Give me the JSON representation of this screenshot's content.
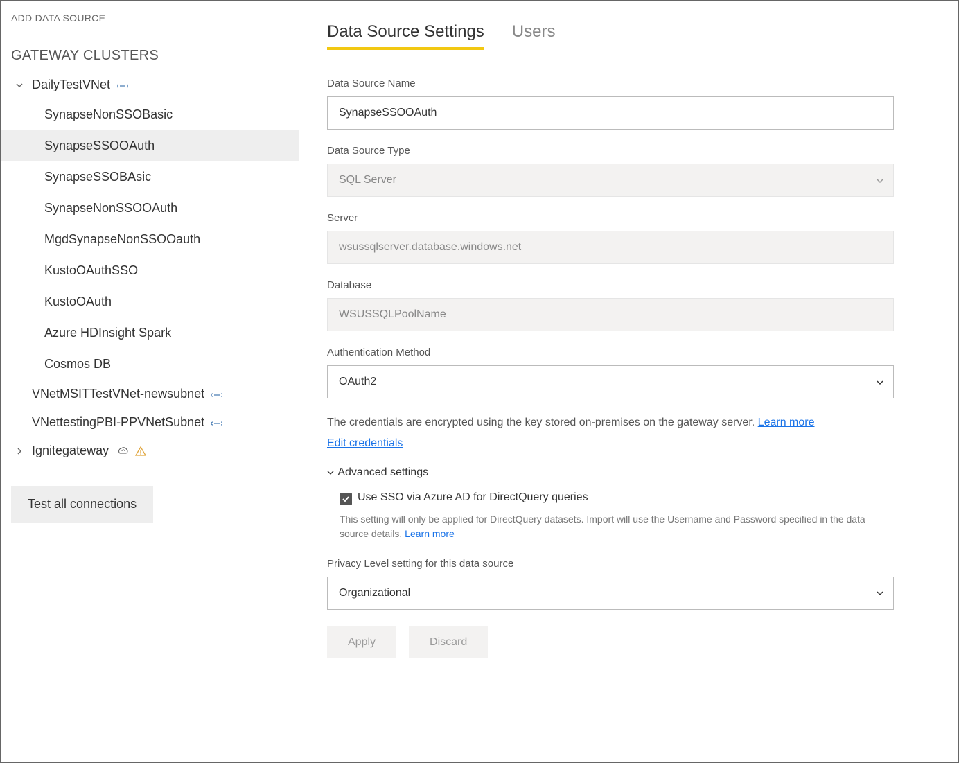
{
  "sidebar": {
    "add_link": "ADD DATA SOURCE",
    "section_title": "GATEWAY CLUSTERS",
    "clusters": [
      {
        "name": "DailyTestVNet",
        "expanded": true,
        "link_icon": true
      },
      {
        "name": "VNetMSITTestVNet-newsubnet",
        "link_icon": true
      },
      {
        "name": "VNettestingPBI-PPVNetSubnet",
        "link_icon": true
      },
      {
        "name": "Ignitegateway",
        "cloud_icon": true,
        "warn_icon": true,
        "collapsed": true
      }
    ],
    "data_sources": [
      "SynapseNonSSOBasic",
      "SynapseSSOOAuth",
      "SynapseSSOBAsic",
      "SynapseNonSSOOAuth",
      "MgdSynapseNonSSOOauth",
      "KustoOAuthSSO",
      "KustoOAuth",
      "Azure HDInsight Spark",
      "Cosmos DB"
    ],
    "selected_ds": "SynapseSSOOAuth",
    "test_btn": "Test all connections"
  },
  "tabs": {
    "settings": "Data Source Settings",
    "users": "Users"
  },
  "form": {
    "name_label": "Data Source Name",
    "name_value": "SynapseSSOOAuth",
    "type_label": "Data Source Type",
    "type_value": "SQL Server",
    "server_label": "Server",
    "server_value": "wsussqlserver.database.windows.net",
    "db_label": "Database",
    "db_value": "WSUSSQLPoolName",
    "auth_label": "Authentication Method",
    "auth_value": "OAuth2",
    "cred_info": "The credentials are encrypted using the key stored on-premises on the gateway server. ",
    "learn_more": "Learn more",
    "edit_cred": "Edit credentials",
    "adv_header": "Advanced settings",
    "sso_checkbox": "Use SSO via Azure AD for DirectQuery queries",
    "sso_help": "This setting will only be applied for DirectQuery datasets. Import will use the Username and Password specified in the data source details. ",
    "privacy_label": "Privacy Level setting for this data source",
    "privacy_value": "Organizational",
    "apply_btn": "Apply",
    "discard_btn": "Discard"
  }
}
